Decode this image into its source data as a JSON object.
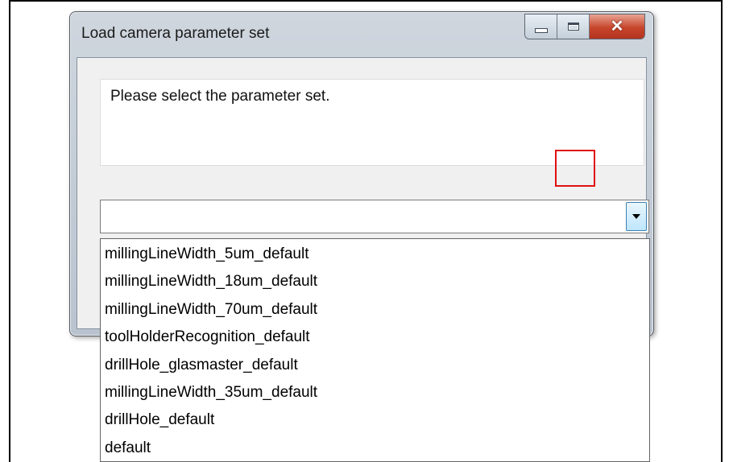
{
  "window": {
    "title": "Load camera parameter set",
    "controls": {
      "minimize": "minimize",
      "maximize": "maximize",
      "close": "close"
    }
  },
  "message": "Please select the parameter set.",
  "combo": {
    "value": ""
  },
  "dropdown": {
    "options": [
      "millingLineWidth_5um_default",
      "millingLineWidth_18um_default",
      "millingLineWidth_70um_default",
      "toolHolderRecognition_default",
      "drillHole_glasmaster_default",
      "millingLineWidth_35um_default",
      "drillHole_default",
      "default"
    ]
  },
  "colors": {
    "highlight": "#e01010",
    "close_button": "#c7452b"
  }
}
